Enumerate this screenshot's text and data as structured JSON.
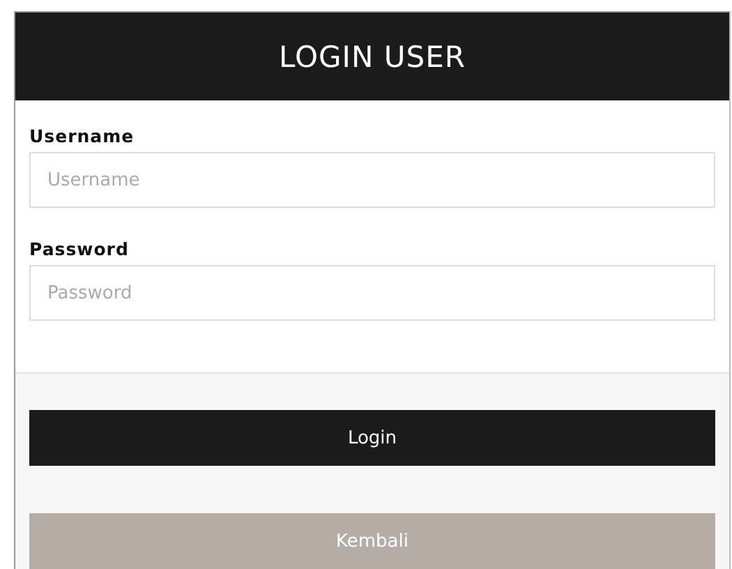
{
  "header": {
    "title": "LOGIN USER"
  },
  "fields": [
    {
      "label": "Username",
      "placeholder": "Username"
    },
    {
      "label": "Password",
      "placeholder": "Password"
    }
  ],
  "buttons": [
    {
      "label": "Login",
      "kind": "primary"
    },
    {
      "label": "Kembali",
      "kind": "secondary"
    }
  ]
}
